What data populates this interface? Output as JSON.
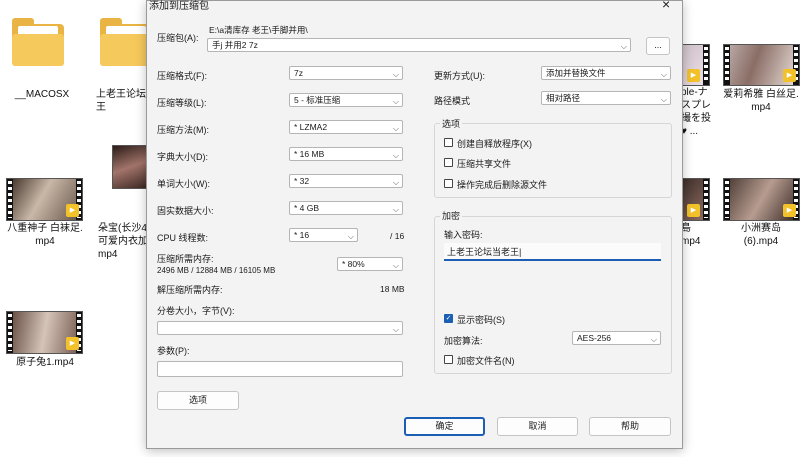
{
  "desktop": {
    "items": [
      {
        "label": "__MACOSX"
      },
      {
        "label": "上老王论坛\n王"
      },
      {
        "label": "八重神子 白袜足.\nmp4"
      },
      {
        "label": "朵宝(长沙4\n可爱内衣加\nmp4"
      },
      {
        "label": "原子兔1.mp4"
      },
      {
        "label": "ple-ナ\nスプレ\n撮を投\n♥ ..."
      },
      {
        "label": "爱莉希雅 白丝足.\nmp4"
      },
      {
        "label": "島\nmp4"
      },
      {
        "label": "小洲赛岛\n(6).mp4"
      }
    ],
    "player_badge": "Player"
  },
  "dialog": {
    "title": "添加到压缩包",
    "close_icon": "×",
    "archive_label": "压缩包(A):",
    "archive_path": "E:\\a清库存 老王\\手脚并用\\",
    "archive_name": "手j 并用2 7z",
    "browse_label": "...",
    "left": {
      "format_label": "压缩格式(F):",
      "format_value": "7z",
      "level_label": "压缩等级(L):",
      "level_value": "5 - 标准压缩",
      "method_label": "压缩方法(M):",
      "method_value": "* LZMA2",
      "dict_label": "字典大小(D):",
      "dict_value": "* 16 MB",
      "word_label": "单词大小(W):",
      "word_value": "* 32",
      "solid_label": "固实数据大小:",
      "solid_value": "* 4 GB",
      "cpu_label": "CPU 线程数:",
      "cpu_value": "* 16",
      "cpu_total": "/ 16",
      "mem_label": "压缩所需内存:",
      "mem_detail": "2496 MB / 12884 MB / 16105 MB",
      "mem_value": "* 80%",
      "dmem_label": "解压缩所需内存:",
      "dmem_value": "18 MB",
      "split_label": "分卷大小，字节(V):",
      "params_label": "参数(P):",
      "options_button": "选项"
    },
    "right": {
      "update_label": "更新方式(U):",
      "update_value": "添加并替换文件",
      "path_label": "路径模式",
      "path_value": "相对路径",
      "options_group": "选项",
      "opt_sfx": "创建自释放程序(X)",
      "opt_shared": "压缩共享文件",
      "opt_delete": "操作完成后删除源文件",
      "enc_group": "加密",
      "enc_label": "输入密码:",
      "enc_password": "上老王论坛当老王|",
      "show_pw": "显示密码(S)",
      "algo_label": "加密算法:",
      "algo_value": "AES-256",
      "enc_names": "加密文件名(N)"
    },
    "buttons": {
      "ok": "确定",
      "cancel": "取消",
      "help": "帮助"
    }
  }
}
